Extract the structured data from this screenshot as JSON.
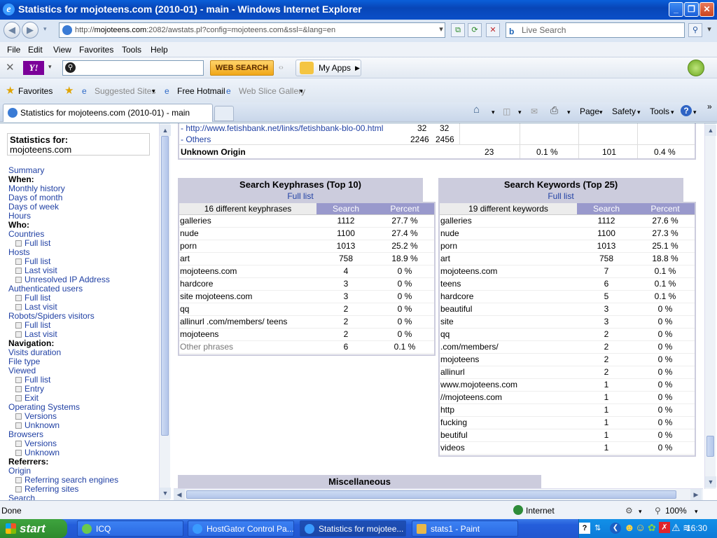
{
  "window": {
    "title": "Statistics for mojoteens.com (2010-01) - main - Windows Internet Explorer"
  },
  "address": {
    "url_prefix": "http://",
    "url_domain": "mojoteens.com",
    "url_rest": ":2082/awstats.pl?config=mojoteens.com&ssl=&lang=en",
    "search_placeholder": "Live Search"
  },
  "menu": [
    "File",
    "Edit",
    "View",
    "Favorites",
    "Tools",
    "Help"
  ],
  "yahoo": {
    "web_search": "WEB SEARCH",
    "my_apps": "My Apps"
  },
  "favorites": {
    "label": "Favorites",
    "suggested": "Suggested Sites",
    "hotmail": "Free Hotmail",
    "slice": "Web Slice Gallery"
  },
  "tab": {
    "title": "Statistics for mojoteens.com (2010-01) - main"
  },
  "commands": {
    "page": "Page",
    "safety": "Safety",
    "tools": "Tools"
  },
  "sidebar": {
    "stats_for": "Statistics for:",
    "domain": "mojoteens.com",
    "summary": "Summary",
    "when": "When:",
    "monthly": "Monthly history",
    "days_month": "Days of month",
    "days_week": "Days of week",
    "hours": "Hours",
    "who": "Who:",
    "countries": "Countries",
    "countries_full": "Full list",
    "hosts": "Hosts",
    "hosts_full": "Full list",
    "hosts_last": "Last visit",
    "hosts_unresolved": "Unresolved IP Address",
    "auth": "Authenticated users",
    "auth_full": "Full list",
    "auth_last": "Last visit",
    "robots": "Robots/Spiders visitors",
    "robots_full": "Full list",
    "robots_last": "Last visit",
    "navigation": "Navigation:",
    "visits_duration": "Visits duration",
    "file_type": "File type",
    "viewed": "Viewed",
    "viewed_full": "Full list",
    "viewed_entry": "Entry",
    "viewed_exit": "Exit",
    "os": "Operating Systems",
    "os_versions": "Versions",
    "os_unknown": "Unknown",
    "browsers": "Browsers",
    "browsers_versions": "Versions",
    "browsers_unknown": "Unknown",
    "referrers": "Referrers:",
    "origin": "Origin",
    "ref_engines": "Referring search engines",
    "ref_sites": "Referring sites",
    "search": "Search"
  },
  "origin_top": {
    "link_row": {
      "label": "- http://www.fetishbank.net/links/fetishbank-blo-00.html",
      "a": "32",
      "b": "32"
    },
    "others_row": {
      "label": "- Others",
      "a": "2246",
      "b": "2456"
    },
    "unknown_row": {
      "label": "Unknown Origin",
      "pages": "23",
      "pages_pct": "0.1 %",
      "hits": "101",
      "hits_pct": "0.4 %"
    }
  },
  "keyphrases": {
    "title": "Search Keyphrases (Top 10)",
    "full_list": "Full list",
    "count_label": "16 different keyphrases",
    "col_search": "Search",
    "col_percent": "Percent",
    "rows": [
      {
        "k": "galleries",
        "n": "1112",
        "p": "27.7 %"
      },
      {
        "k": "nude",
        "n": "1100",
        "p": "27.4 %"
      },
      {
        "k": "porn",
        "n": "1013",
        "p": "25.2 %"
      },
      {
        "k": "art",
        "n": "758",
        "p": "18.9 %"
      },
      {
        "k": "mojoteens.com",
        "n": "4",
        "p": "0 %"
      },
      {
        "k": "hardcore",
        "n": "3",
        "p": "0 %"
      },
      {
        "k": "site mojoteens.com",
        "n": "3",
        "p": "0 %"
      },
      {
        "k": "qq",
        "n": "2",
        "p": "0 %"
      },
      {
        "k": "allinurl .com/members/ teens",
        "n": "2",
        "p": "0 %"
      },
      {
        "k": "mojoteens",
        "n": "2",
        "p": "0 %"
      },
      {
        "k": "Other phrases",
        "n": "6",
        "p": "0.1 %"
      }
    ]
  },
  "keywords": {
    "title": "Search Keywords (Top 25)",
    "full_list": "Full list",
    "count_label": "19 different keywords",
    "col_search": "Search",
    "col_percent": "Percent",
    "rows": [
      {
        "k": "galleries",
        "n": "1112",
        "p": "27.6 %"
      },
      {
        "k": "nude",
        "n": "1100",
        "p": "27.3 %"
      },
      {
        "k": "porn",
        "n": "1013",
        "p": "25.1 %"
      },
      {
        "k": "art",
        "n": "758",
        "p": "18.8 %"
      },
      {
        "k": "mojoteens.com",
        "n": "7",
        "p": "0.1 %"
      },
      {
        "k": "teens",
        "n": "6",
        "p": "0.1 %"
      },
      {
        "k": "hardcore",
        "n": "5",
        "p": "0.1 %"
      },
      {
        "k": "beautiful",
        "n": "3",
        "p": "0 %"
      },
      {
        "k": "site",
        "n": "3",
        "p": "0 %"
      },
      {
        "k": "qq",
        "n": "2",
        "p": "0 %"
      },
      {
        "k": ".com/members/",
        "n": "2",
        "p": "0 %"
      },
      {
        "k": "mojoteens",
        "n": "2",
        "p": "0 %"
      },
      {
        "k": "allinurl",
        "n": "2",
        "p": "0 %"
      },
      {
        "k": "www.mojoteens.com",
        "n": "1",
        "p": "0 %"
      },
      {
        "k": "//mojoteens.com",
        "n": "1",
        "p": "0 %"
      },
      {
        "k": "http",
        "n": "1",
        "p": "0 %"
      },
      {
        "k": "fucking",
        "n": "1",
        "p": "0 %"
      },
      {
        "k": "beutiful",
        "n": "1",
        "p": "0 %"
      },
      {
        "k": "videos",
        "n": "1",
        "p": "0 %"
      }
    ]
  },
  "misc": {
    "title": "Miscellaneous"
  },
  "status": {
    "text": "Done",
    "zone": "Internet",
    "zoom": "100%"
  },
  "taskbar": {
    "start": "start",
    "items": [
      "ICQ",
      "HostGator Control Pa...",
      "Statistics for mojotee...",
      "stats1 - Paint"
    ],
    "clock": "16:30"
  }
}
